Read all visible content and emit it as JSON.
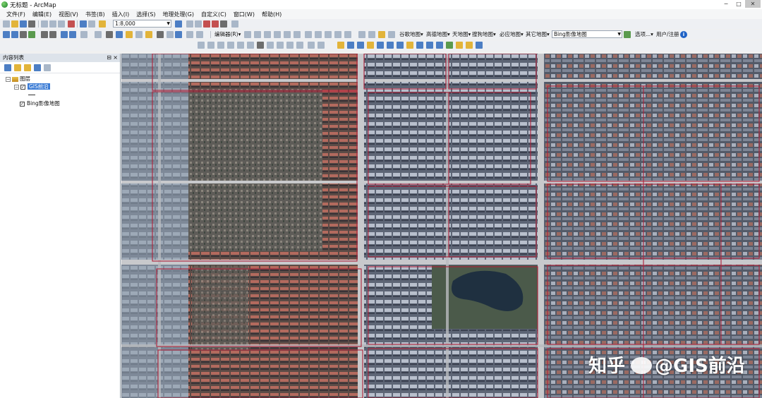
{
  "window": {
    "title": "无标题 - ArcMap"
  },
  "menu": [
    "文件(F)",
    "编辑(E)",
    "视图(V)",
    "书签(B)",
    "插入(I)",
    "选择(S)",
    "地理处理(G)",
    "自定义(C)",
    "窗口(W)",
    "帮助(H)"
  ],
  "toolbar": {
    "scale": "1:8,000",
    "editor_label": "编辑器(R)▾",
    "map_menus": [
      "谷歌地图▾",
      "高德地图▾",
      "天地图▾",
      "搜狗地图▾",
      "必应地图▾",
      "其它地图▾"
    ],
    "basemap_select": "Bing影像地图",
    "options_label": "选项...▾",
    "user_label": "用户/注册",
    "help_glyph": "i"
  },
  "toc": {
    "title": "内容列表",
    "pin_glyph": "⊟",
    "close_glyph": "×",
    "root": "图层",
    "layers": [
      {
        "name": "GIS前沿",
        "checked": true,
        "selected": true
      },
      {
        "name": "Bing影像地图",
        "checked": true,
        "selected": false
      }
    ]
  },
  "watermark": {
    "brand": "知乎",
    "handle": "@GIS前沿"
  },
  "colors": {
    "block_outline": "#b0223a",
    "road": "#c8c9cc",
    "panel_header": "#dde3ea"
  }
}
